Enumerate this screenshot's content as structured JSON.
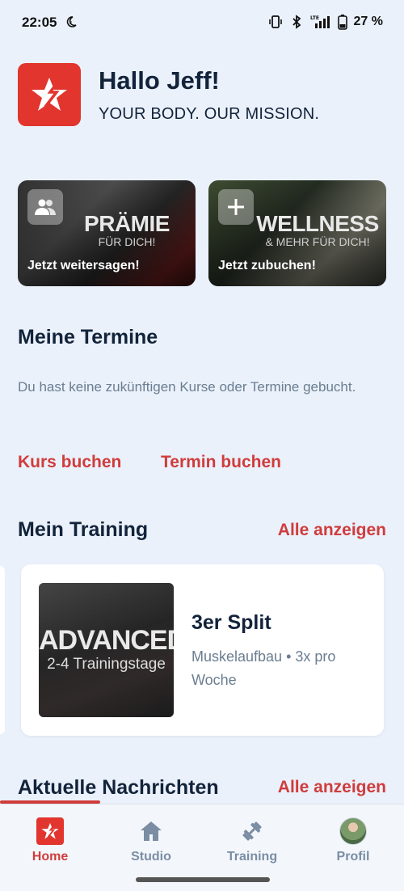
{
  "status_bar": {
    "time": "22:05",
    "battery_text": "27 %",
    "network": "LTE"
  },
  "header": {
    "greeting": "Hallo Jeff!",
    "tagline": "YOUR BODY. OUR MISSION."
  },
  "promos": [
    {
      "title": "PRÄMIE",
      "subtitle": "FÜR DICH!",
      "cta": "Jetzt weitersagen!",
      "icon": "people-icon"
    },
    {
      "title": "WELLNESS",
      "subtitle": "& MEHR FÜR DICH!",
      "cta": "Jetzt zubuchen!",
      "icon": "plus-icon"
    }
  ],
  "appointments": {
    "heading": "Meine Termine",
    "empty_text": "Du hast keine zukünftigen Kurse oder Termine gebucht.",
    "book_course": "Kurs buchen",
    "book_appointment": "Termin buchen"
  },
  "training": {
    "heading": "Mein Training",
    "show_all": "Alle anzeigen",
    "plan": {
      "thumb_title": "ADVANCED",
      "thumb_subtitle": "2-4 Trainingstage",
      "name": "3er Split",
      "description": "Muskelaufbau • 3x pro Woche"
    }
  },
  "news": {
    "heading": "Aktuelle Nachrichten",
    "show_all": "Alle anzeigen"
  },
  "bottom_nav": [
    {
      "label": "Home",
      "icon": "home-logo-icon",
      "active": true
    },
    {
      "label": "Studio",
      "icon": "house-icon",
      "active": false
    },
    {
      "label": "Training",
      "icon": "dumbbell-icon",
      "active": false
    },
    {
      "label": "Profil",
      "icon": "avatar",
      "active": false
    }
  ],
  "colors": {
    "accent": "#d03c3c",
    "brand_red": "#e1352e",
    "background": "#eaf1fb",
    "text_dark": "#12233a",
    "text_muted": "#6b7d90"
  }
}
